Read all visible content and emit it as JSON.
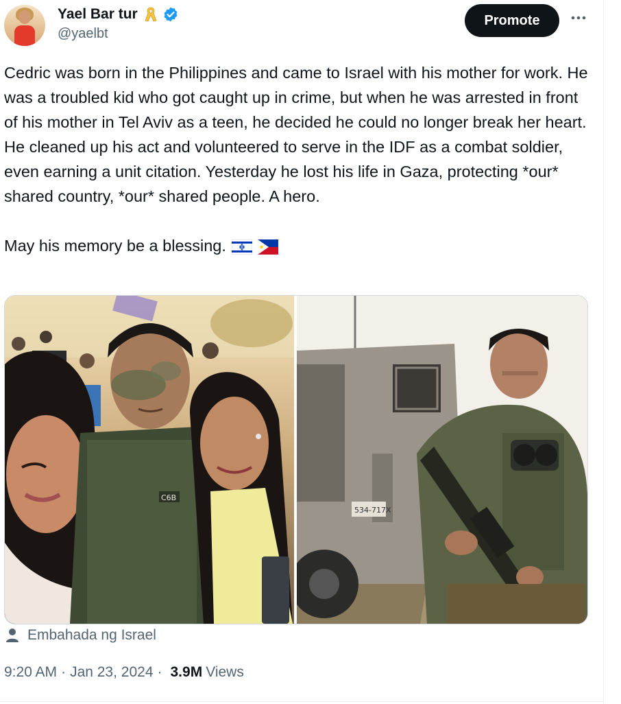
{
  "author": {
    "display_name": "Yael Bar tur",
    "handle": "@yaelbt",
    "icons": [
      "yellow-ribbon-icon",
      "verified-badge-icon"
    ]
  },
  "actions": {
    "promote_label": "Promote",
    "more_icon": "more-horizontal-icon"
  },
  "tweet": {
    "paragraph_1": "Cedric was born in the Philippines and came to Israel with his mother for work. He was a troubled kid who got caught up in crime, but when he was arrested in front of his mother in Tel Aviv as a teen, he decided he could no longer break her heart. He cleaned up his act and volunteered to serve in the IDF as a combat soldier, even earning a unit citation. Yesterday he lost his life in Gaza, protecting *our* shared country, *our* shared people. A hero.",
    "paragraph_2": "May his memory be a blessing.",
    "flags": [
      "israel-flag-icon",
      "philippines-flag-icon"
    ]
  },
  "media": {
    "photos": [
      {
        "subject": "selfie-photo",
        "vest_tag": "C6B"
      },
      {
        "subject": "soldier-photo",
        "plate": "534-717X"
      }
    ]
  },
  "attribution": {
    "icon": "person-icon",
    "label": "Embahada ng Israel"
  },
  "meta": {
    "time": "9:20 AM",
    "date": "Jan 23, 2024",
    "views_count": "3.9M",
    "views_label": "Views"
  },
  "colors": {
    "text_primary": "#0f1419",
    "text_secondary": "#536471",
    "verified_blue": "#1d9bf0",
    "ribbon_yellow": "#f6c243",
    "button_black": "#0f1419"
  }
}
